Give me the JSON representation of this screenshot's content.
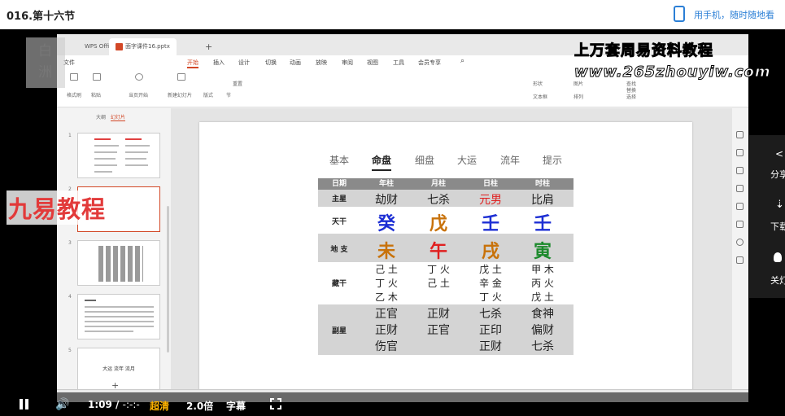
{
  "page": {
    "title": "016.第十六节",
    "phone_link": "用手机，随时随地看"
  },
  "app": {
    "tabs": [
      "WPS Office",
      "面字课件16.pptx"
    ],
    "menus": [
      "文件",
      "开始",
      "插入",
      "设计",
      "切换",
      "动画",
      "放映",
      "审阅",
      "视图",
      "工具",
      "会员专享"
    ],
    "active_menu": "开始",
    "ribbon": [
      "格式刷",
      "粘贴",
      "当页开始",
      "新建幻灯片",
      "版式",
      "节",
      "重置",
      "形状",
      "图片",
      "文本框",
      "排列",
      "查找",
      "替换",
      "选择"
    ],
    "thumb_tabs": [
      "大纲",
      "幻灯片"
    ],
    "thumb_numbers": [
      "1",
      "2",
      "3",
      "4",
      "5"
    ],
    "thumb5_text": "大运 流年 流月"
  },
  "slide": {
    "tabs": [
      "基本",
      "命盘",
      "细盘",
      "大运",
      "流年",
      "提示"
    ],
    "active_tab": "命盘",
    "header": [
      "日期",
      "年柱",
      "月柱",
      "日柱",
      "时柱"
    ],
    "zhuxing": {
      "label": "主星",
      "values": [
        "劫财",
        "七杀",
        "元男",
        "比肩"
      ],
      "colors": [
        "#222222",
        "#222222",
        "#e02020",
        "#222222"
      ]
    },
    "tiangan": {
      "label": "天干",
      "values": [
        "癸",
        "戊",
        "壬",
        "壬"
      ],
      "colors": [
        "#1d2fd4",
        "#c8720a",
        "#1d2fd4",
        "#1d2fd4"
      ]
    },
    "dizhi": {
      "label": "地 支",
      "values": [
        "未",
        "午",
        "戌",
        "寅"
      ],
      "colors": [
        "#c8720a",
        "#e02020",
        "#c8720a",
        "#1c8a2c"
      ]
    },
    "canggan": {
      "label": "藏干",
      "values": [
        [
          "己 土",
          "丁 火",
          "乙 木"
        ],
        [
          "丁 火",
          "己 土"
        ],
        [
          "戊 土",
          "辛 金",
          "丁 火"
        ],
        [
          "甲 木",
          "丙 火",
          "戊 土"
        ]
      ]
    },
    "fuxing": {
      "label": "副星",
      "values": [
        [
          "正官",
          "正财",
          "伤官"
        ],
        [
          "正财",
          "正官"
        ],
        [
          "七杀",
          "正印",
          "正财"
        ],
        [
          "食神",
          "偏财",
          "七杀"
        ]
      ]
    }
  },
  "watermarks": {
    "left_top": [
      "白",
      "洲"
    ],
    "top_right_1": "上万套周易资料教程",
    "top_right_2": "www.265zhouyiw.com",
    "mid_left": "九易教程"
  },
  "side_panel": [
    "分享",
    "下载",
    "关灯"
  ],
  "player": {
    "time": "1:09",
    "separator": "/",
    "duration": "-:-:-",
    "quality": "超清",
    "speed": "2.0倍",
    "subtitle": "字幕"
  },
  "colors": {
    "header_band": "#8a8a8a",
    "light_band": "#d4d4d4",
    "accent": "#d24726"
  }
}
